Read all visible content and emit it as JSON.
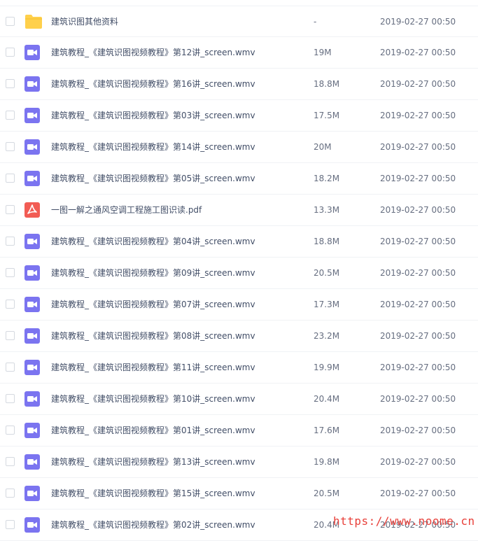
{
  "colors": {
    "folder": "#ffd04b",
    "video": "#7b74f0",
    "pdf": "#f25c54",
    "watermark": "#e8403a"
  },
  "files": [
    {
      "type": "folder",
      "icon": "folder-icon",
      "name": "建筑识图其他资料",
      "size": "-",
      "time": "2019-02-27 00:50"
    },
    {
      "type": "video",
      "icon": "video-file-icon",
      "name": "建筑教程_《建筑识图视频教程》第12讲_screen.wmv",
      "size": "19M",
      "time": "2019-02-27 00:50"
    },
    {
      "type": "video",
      "icon": "video-file-icon",
      "name": "建筑教程_《建筑识图视频教程》第16讲_screen.wmv",
      "size": "18.8M",
      "time": "2019-02-27 00:50"
    },
    {
      "type": "video",
      "icon": "video-file-icon",
      "name": "建筑教程_《建筑识图视频教程》第03讲_screen.wmv",
      "size": "17.5M",
      "time": "2019-02-27 00:50"
    },
    {
      "type": "video",
      "icon": "video-file-icon",
      "name": "建筑教程_《建筑识图视频教程》第14讲_screen.wmv",
      "size": "20M",
      "time": "2019-02-27 00:50"
    },
    {
      "type": "video",
      "icon": "video-file-icon",
      "name": "建筑教程_《建筑识图视频教程》第05讲_screen.wmv",
      "size": "18.2M",
      "time": "2019-02-27 00:50"
    },
    {
      "type": "pdf",
      "icon": "pdf-file-icon",
      "name": "一图一解之通风空调工程施工图识读.pdf",
      "size": "13.3M",
      "time": "2019-02-27 00:50"
    },
    {
      "type": "video",
      "icon": "video-file-icon",
      "name": "建筑教程_《建筑识图视频教程》第04讲_screen.wmv",
      "size": "18.8M",
      "time": "2019-02-27 00:50"
    },
    {
      "type": "video",
      "icon": "video-file-icon",
      "name": "建筑教程_《建筑识图视频教程》第09讲_screen.wmv",
      "size": "20.5M",
      "time": "2019-02-27 00:50"
    },
    {
      "type": "video",
      "icon": "video-file-icon",
      "name": "建筑教程_《建筑识图视频教程》第07讲_screen.wmv",
      "size": "17.3M",
      "time": "2019-02-27 00:50"
    },
    {
      "type": "video",
      "icon": "video-file-icon",
      "name": "建筑教程_《建筑识图视频教程》第08讲_screen.wmv",
      "size": "23.2M",
      "time": "2019-02-27 00:50"
    },
    {
      "type": "video",
      "icon": "video-file-icon",
      "name": "建筑教程_《建筑识图视频教程》第11讲_screen.wmv",
      "size": "19.9M",
      "time": "2019-02-27 00:50"
    },
    {
      "type": "video",
      "icon": "video-file-icon",
      "name": "建筑教程_《建筑识图视频教程》第10讲_screen.wmv",
      "size": "20.4M",
      "time": "2019-02-27 00:50"
    },
    {
      "type": "video",
      "icon": "video-file-icon",
      "name": "建筑教程_《建筑识图视频教程》第01讲_screen.wmv",
      "size": "17.6M",
      "time": "2019-02-27 00:50"
    },
    {
      "type": "video",
      "icon": "video-file-icon",
      "name": "建筑教程_《建筑识图视频教程》第13讲_screen.wmv",
      "size": "19.8M",
      "time": "2019-02-27 00:50"
    },
    {
      "type": "video",
      "icon": "video-file-icon",
      "name": "建筑教程_《建筑识图视频教程》第15讲_screen.wmv",
      "size": "20.5M",
      "time": "2019-02-27 00:50"
    },
    {
      "type": "video",
      "icon": "video-file-icon",
      "name": "建筑教程_《建筑识图视频教程》第02讲_screen.wmv",
      "size": "20.4M",
      "time": "2019-02-27 00:50"
    }
  ],
  "watermark": "https://www.noome.cn"
}
